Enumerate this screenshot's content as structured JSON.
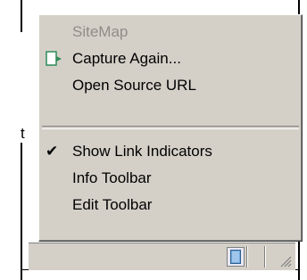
{
  "background": {
    "partial_text": "t"
  },
  "menu": {
    "items": [
      {
        "label": "SiteMap",
        "enabled": false
      },
      {
        "label": "Capture Again...",
        "icon": "capture-icon"
      },
      {
        "label": "Open Source URL"
      },
      {
        "label": "Show Link Indicators",
        "checked": true
      },
      {
        "label": "Info Toolbar"
      },
      {
        "label": "Edit Toolbar"
      }
    ]
  },
  "status_bar": {
    "icon": "page-icon"
  },
  "colors": {
    "menu_background": "#d4d0c8",
    "disabled_text": "#8f8d88",
    "border": "#000000"
  }
}
